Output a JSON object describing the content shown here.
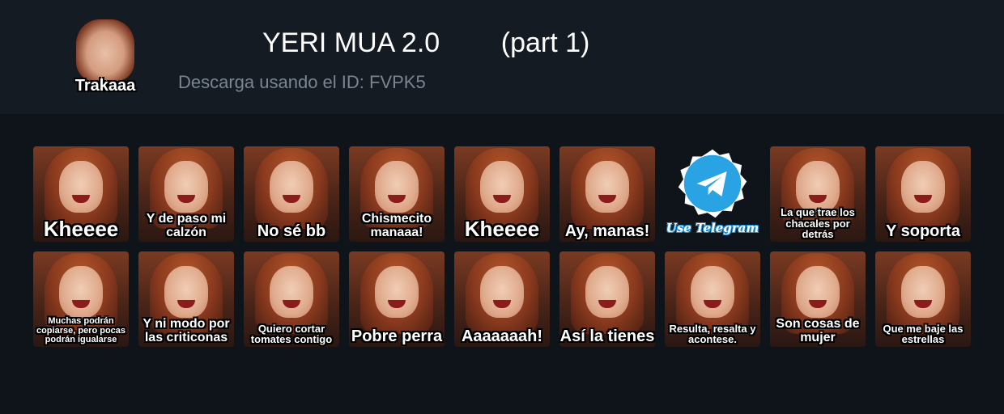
{
  "header": {
    "thumb_caption": "Trakaaa",
    "title": "YERI MUA 2.0        (part 1)",
    "download_text": "Descarga usando el ID: FVPK5"
  },
  "stickers_row1": [
    {
      "caption": "Kheeee",
      "size": "xl"
    },
    {
      "caption": "Y de paso mi calzón",
      "size": "md"
    },
    {
      "caption": "No sé bb",
      "size": "lg"
    },
    {
      "caption": "Chismecito manaaa!",
      "size": "md"
    },
    {
      "caption": "Kheeee",
      "size": "xl"
    },
    {
      "caption": "Ay, manas!",
      "size": "lg"
    },
    {
      "caption": "Use Telegram",
      "type": "telegram"
    },
    {
      "caption": "La que trae los chacales por detrás",
      "size": "sm"
    },
    {
      "caption": "Y soporta",
      "size": "lg"
    }
  ],
  "stickers_row2": [
    {
      "caption": "Muchas podrán copiarse, pero pocas podrán igualarse",
      "size": "xs"
    },
    {
      "caption": "Y ni modo por las criticonas",
      "size": "md"
    },
    {
      "caption": "Quiero cortar tomates contigo",
      "size": "sm"
    },
    {
      "caption": "Pobre perra",
      "size": "lg"
    },
    {
      "caption": "Aaaaaaah!",
      "size": "lg"
    },
    {
      "caption": "Así la tienes",
      "size": "lg"
    },
    {
      "caption": "Resulta, resalta y acontese.",
      "size": "sm"
    },
    {
      "caption": "Son cosas de mujer",
      "size": "md"
    },
    {
      "caption": "Que me baje las estrellas",
      "size": "sm"
    }
  ],
  "colors": {
    "page_bg": "#0e141a",
    "header_bg": "#141b22",
    "title": "#ffffff",
    "subtitle": "#7a8590",
    "telegram_blue": "#2aa3e4"
  }
}
